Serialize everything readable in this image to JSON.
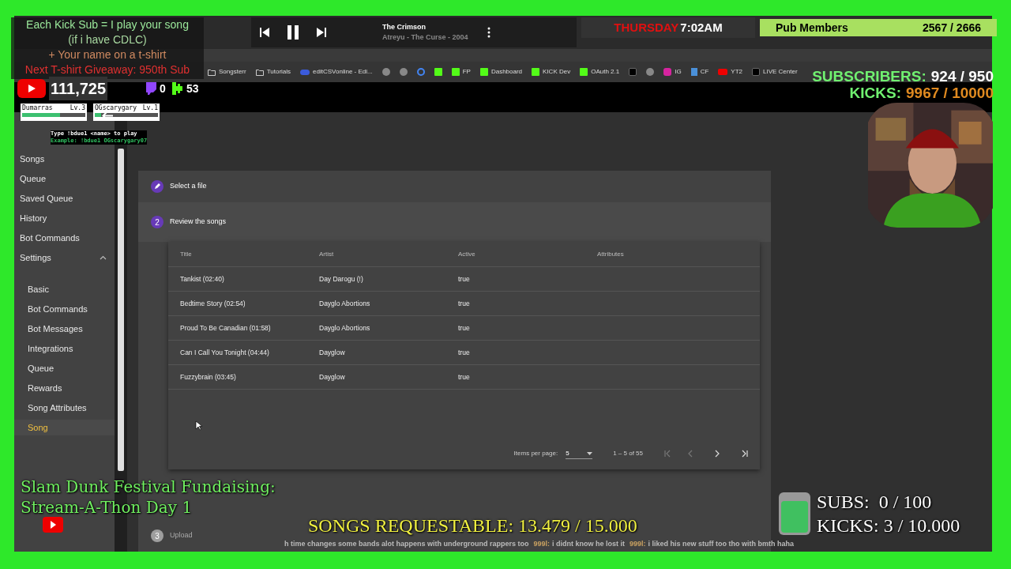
{
  "promo": {
    "lines": [
      {
        "text": "Each Kick Sub = I play your song",
        "color": "#9be89b"
      },
      {
        "text": "(if i have CDLC)",
        "color": "#a8d8a0"
      },
      {
        "text": "+ Your name on a t-shirt",
        "color": "#d08a60"
      },
      {
        "text": "Next T-shirt Giveaway: 950th Sub",
        "color": "#e03030"
      }
    ]
  },
  "counters": [
    {
      "kind": "youtube",
      "value": "111,725"
    },
    {
      "kind": "twitch",
      "value": "0"
    },
    {
      "kind": "kick",
      "value": "53"
    }
  ],
  "media_player": {
    "title": "The Crimson",
    "subtitle": "Atreyu - The Curse - 2004",
    "playing": true
  },
  "clock": {
    "day": "THURSDAY",
    "time": "7:02AM"
  },
  "pub_members": {
    "label": "Pub Members",
    "count": "2567 / 2666"
  },
  "goals_top": [
    {
      "label": "SUBSCRIBERS:",
      "value": "924 / 950",
      "color": "#ffffff"
    },
    {
      "label": "KICKS:",
      "value": "9967 / 10000",
      "color": "#e08a20"
    }
  ],
  "bookmarks": [
    {
      "kind": "folder",
      "label": "Songsterr"
    },
    {
      "kind": "folder",
      "label": "Tutorials"
    },
    {
      "kind": "csv",
      "label": "editCSVonline - Edi..."
    },
    {
      "kind": "generic"
    },
    {
      "kind": "generic"
    },
    {
      "kind": "google"
    },
    {
      "kind": "kick"
    },
    {
      "kind": "kick",
      "label": "FP"
    },
    {
      "kind": "kick",
      "label": "Dashboard"
    },
    {
      "kind": "kick",
      "label": "KICK Dev"
    },
    {
      "kind": "kick",
      "label": "OAuth 2.1"
    },
    {
      "kind": "tiktok"
    },
    {
      "kind": "generic"
    },
    {
      "kind": "instagram",
      "label": "IG"
    },
    {
      "kind": "cf",
      "label": "CF"
    },
    {
      "kind": "youtube",
      "label": "YT2"
    },
    {
      "kind": "tiktok",
      "label": "LIVE Center"
    }
  ],
  "duel": {
    "players": [
      {
        "name": "Dumarras",
        "rank": "Lv.3",
        "level": 0.6
      },
      {
        "name": "OGscarygary",
        "rank": "Lv.1",
        "level": 0.1
      }
    ],
    "instruction": "Type !bdue1 <name> to play",
    "example": "Example: !bdue1 OGscarygary07"
  },
  "sidebar": {
    "items": [
      {
        "label": "Songs",
        "selected": false
      },
      {
        "label": "Queue",
        "selected": false
      },
      {
        "label": "Saved Queue",
        "selected": false
      },
      {
        "label": "History",
        "selected": false
      },
      {
        "label": "Bot Commands",
        "selected": false
      },
      {
        "label": "Settings",
        "selected": false,
        "expanded": true,
        "children": [
          {
            "label": "Basic",
            "selected": false
          },
          {
            "label": "Bot Commands",
            "selected": false
          },
          {
            "label": "Bot Messages",
            "selected": false
          },
          {
            "label": "Integrations",
            "selected": false
          },
          {
            "label": "Queue",
            "selected": false
          },
          {
            "label": "Rewards",
            "selected": false
          },
          {
            "label": "Song Attributes",
            "selected": false
          },
          {
            "label": "Song",
            "selected": true
          }
        ]
      }
    ]
  },
  "steps": [
    {
      "kind": "edit",
      "label": "Select a file"
    },
    {
      "kind": "number",
      "number": "2",
      "label": "Review the songs",
      "active": true
    },
    {
      "kind": "number",
      "number": "3",
      "label": "Upload",
      "active": false
    }
  ],
  "table": {
    "columns": [
      "Title",
      "Artist",
      "Active",
      "Attributes"
    ],
    "rows": [
      [
        "Tankist (02:40)",
        "Day Darogu (!)",
        "true"
      ],
      [
        "Bedtime Story (02:54)",
        "Dayglo Abortions",
        "true"
      ],
      [
        "Proud To Be Canadian (01:58)",
        "Dayglo Abortions",
        "true"
      ],
      [
        "Can I Call You Tonight (04:44)",
        "Dayglow",
        "true"
      ],
      [
        "Fuzzybrain (03:45)",
        "Dayglow",
        "true"
      ]
    ]
  },
  "paginator": {
    "label": "Items per page:",
    "page_size": "5",
    "range": "1 – 5 of 55"
  },
  "event_title": [
    "Slam Dunk Festival Fundaising:",
    "Stream-A-Thon Day 1"
  ],
  "songs_requestable": "SONGS REQUESTABLE: 13.479 / 15.000",
  "jar_goals": [
    "SUBS:  0 / 100",
    "KICKS: 3 / 10.000"
  ],
  "ticker": [
    {
      "text": "h time changes some bands alot happens with underground rappers too"
    },
    {
      "user": "999l:",
      "text": "i didnt know he lost it"
    },
    {
      "user": "999l:",
      "text": "i liked his new stuff too tho with bmth haha"
    }
  ]
}
